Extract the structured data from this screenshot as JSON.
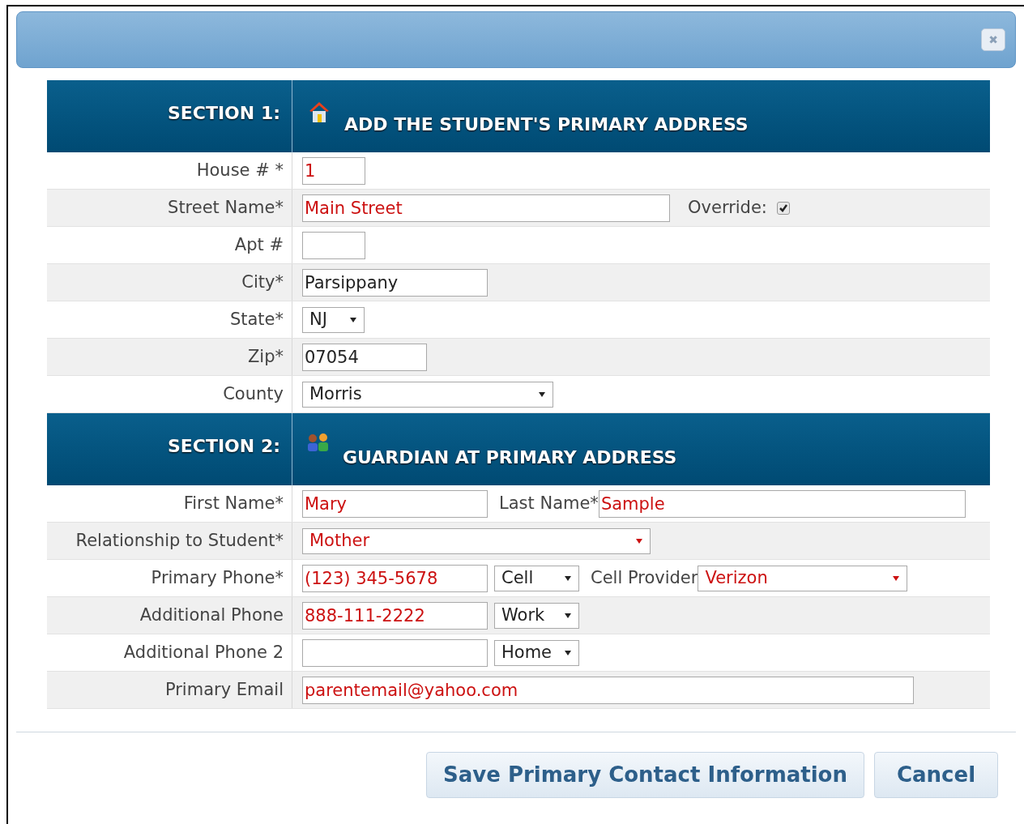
{
  "dialog": {
    "close": "✖"
  },
  "sections": [
    {
      "heading": "SECTION 1:",
      "title": "ADD THE STUDENT'S PRIMARY ADDRESS",
      "rows": [
        {
          "label": "House # *",
          "fields": [
            {
              "kind": "text",
              "value": "1",
              "changed": true
            }
          ]
        },
        {
          "label": "Street Name*",
          "fields": [
            {
              "kind": "text",
              "value": "Main Street",
              "changed": true
            },
            {
              "kind": "checkbox",
              "label": "Override:",
              "checked": true
            }
          ]
        },
        {
          "label": "Apt #",
          "fields": [
            {
              "kind": "text"
            }
          ]
        },
        {
          "label": "City*",
          "fields": [
            {
              "kind": "text",
              "value": "Parsippany",
              "changed": false
            }
          ]
        },
        {
          "label": "State*",
          "fields": [
            {
              "kind": "select",
              "value": "NJ",
              "changed": false
            }
          ]
        },
        {
          "label": "Zip*",
          "fields": [
            {
              "kind": "text",
              "value": "07054",
              "changed": false
            }
          ]
        },
        {
          "label": "County",
          "fields": [
            {
              "kind": "select",
              "value": "Morris",
              "changed": false
            }
          ]
        }
      ]
    },
    {
      "heading": "SECTION 2:",
      "title": "GUARDIAN AT PRIMARY ADDRESS",
      "rows": [
        {
          "label": "First Name*",
          "fields": [
            {
              "kind": "text",
              "value": "Mary",
              "changed": true
            },
            {
              "kind": "label",
              "text": "Last Name*"
            },
            {
              "kind": "text",
              "value": "Sample",
              "changed": true
            }
          ]
        },
        {
          "label": "Relationship to Student*",
          "fields": [
            {
              "kind": "select",
              "value": "Mother",
              "changed": true
            }
          ]
        },
        {
          "label": "Primary Phone*",
          "fields": [
            {
              "kind": "text",
              "value": "(123) 345-5678",
              "changed": true
            },
            {
              "kind": "select",
              "value": "Cell",
              "changed": false
            },
            {
              "kind": "label",
              "text": "Cell Provider"
            },
            {
              "kind": "select",
              "value": "Verizon",
              "changed": true
            }
          ]
        },
        {
          "label": "Additional Phone",
          "fields": [
            {
              "kind": "text",
              "value": "888-111-2222",
              "changed": true
            },
            {
              "kind": "select",
              "value": "Work",
              "changed": false
            }
          ]
        },
        {
          "label": "Additional Phone 2",
          "fields": [
            {
              "kind": "text"
            },
            {
              "kind": "select",
              "value": "Home",
              "changed": false
            }
          ]
        },
        {
          "label": "Primary Email",
          "fields": [
            {
              "kind": "text",
              "value": "parentemail@yahoo.com",
              "changed": true
            }
          ]
        }
      ]
    }
  ],
  "buttons": [
    {
      "label": "Save Primary Contact Information"
    },
    {
      "label": "Cancel"
    }
  ]
}
